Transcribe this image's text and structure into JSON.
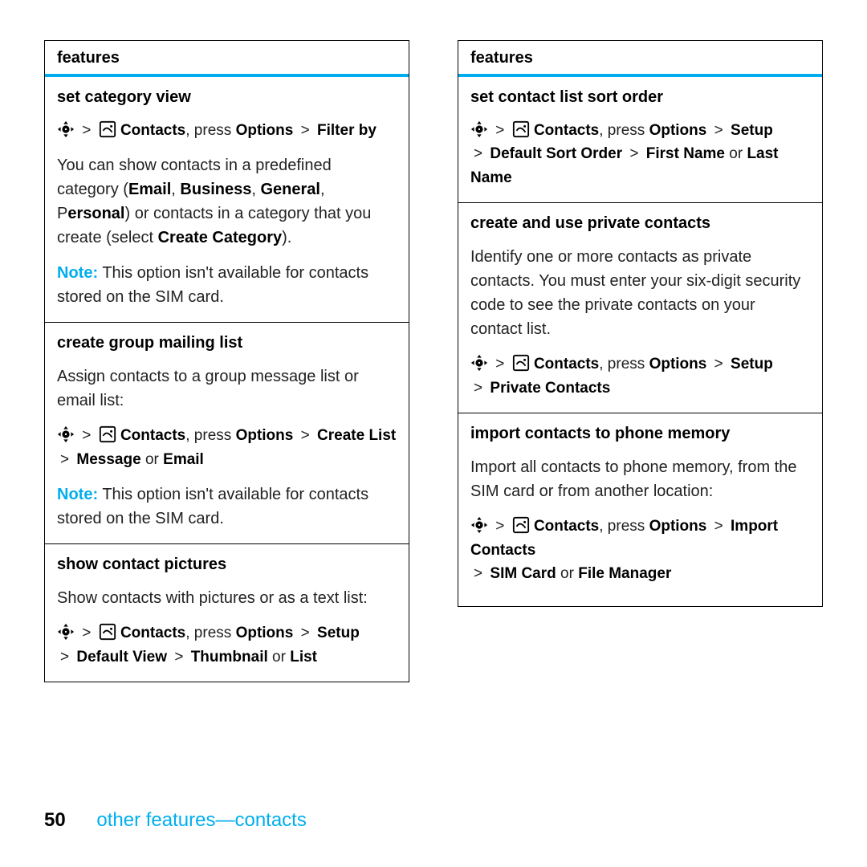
{
  "header_label": "features",
  "footer": {
    "page": "50",
    "section": "other features—contacts"
  },
  "nav_icon": "nav-key-icon",
  "contacts_icon": "contacts-icon",
  "gt": ">",
  "sep": ", press",
  "or": "or",
  "note_prefix": "Note:",
  "left": [
    {
      "title": "set category view",
      "path": {
        "menu": "Contacts",
        "action1": "Options",
        "action2": "Filter by"
      },
      "body1_a": "You can show contacts in a predefined category (",
      "body1_opts": [
        "Email",
        "Business",
        "General",
        "Personal"
      ],
      "body1_b": ") or contacts in a category that you create (select ",
      "body1_c": "Create Category",
      "body1_d": ").",
      "note": "This option isn't available for contacts stored on the SIM card."
    },
    {
      "title": "create group mailing list",
      "intro": "Assign contacts to a group message list or email list:",
      "path": {
        "menu": "Contacts",
        "action1": "Options",
        "action2": "Create List",
        "sub1": "Message",
        "sub2": "Email"
      },
      "note": "This option isn't available for contacts stored on the SIM card."
    },
    {
      "title": "show contact pictures",
      "intro": "Show contacts with pictures or as a text list:",
      "path": {
        "menu": "Contacts",
        "action1": "Options",
        "action2": "Setup",
        "sub1": "Default View",
        "sub2": "Thumbnail",
        "sub3": "List"
      }
    }
  ],
  "right": [
    {
      "title": "set contact list sort order",
      "path": {
        "menu": "Contacts",
        "action1": "Options",
        "action2": "Setup",
        "sub1": "Default Sort Order",
        "sub2": "First Name",
        "sub3": "Last Name"
      }
    },
    {
      "title": "create and use private contacts",
      "intro": "Identify one or more contacts as private contacts. You must enter your six-digit security code to see the private contacts on your contact list.",
      "path": {
        "menu": "Contacts",
        "action1": "Options",
        "action2": "Setup",
        "sub1": "Private Contacts"
      }
    },
    {
      "title": "import contacts to phone memory",
      "intro": "Import all contacts to phone memory, from the SIM card or from another location:",
      "path": {
        "menu": "Contacts",
        "action1": "Options",
        "action2": "Import Contacts",
        "sub1": "SIM Card",
        "sub2": "File Manager"
      }
    }
  ]
}
